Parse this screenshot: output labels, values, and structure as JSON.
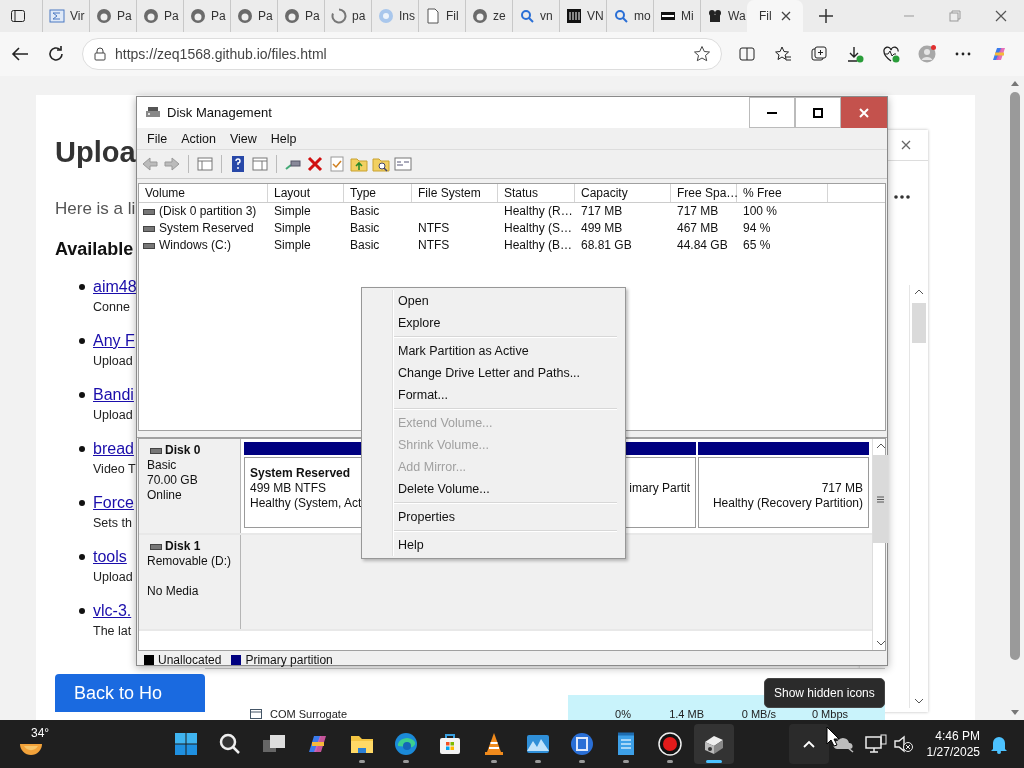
{
  "browser": {
    "tabs": [
      {
        "kind": "mail",
        "label": "Vir",
        "selected": false
      },
      {
        "kind": "github",
        "label": "Pa",
        "selected": false
      },
      {
        "kind": "github",
        "label": "Pa",
        "selected": false
      },
      {
        "kind": "github",
        "label": "Pa",
        "selected": false
      },
      {
        "kind": "github",
        "label": "Pa",
        "selected": false
      },
      {
        "kind": "github",
        "label": "Pa",
        "selected": false
      },
      {
        "kind": "ring",
        "label": "pa",
        "selected": false
      },
      {
        "kind": "circle",
        "label": "Ins",
        "selected": false
      },
      {
        "kind": "doc",
        "label": "Fil",
        "selected": false
      },
      {
        "kind": "github",
        "label": "ze",
        "selected": false
      },
      {
        "kind": "search",
        "label": "vn",
        "selected": false
      },
      {
        "kind": "bank",
        "label": "VN",
        "selected": false
      },
      {
        "kind": "search",
        "label": "mo",
        "selected": false
      },
      {
        "kind": "film",
        "label": "Mi",
        "selected": false
      },
      {
        "kind": "camera",
        "label": "Wa",
        "selected": false
      },
      {
        "kind": "loading",
        "label": "Fil",
        "selected": true
      }
    ],
    "address": "https://zeq1568.github.io/files.html"
  },
  "page": {
    "heading": "Uploa",
    "intro": "Here is a li",
    "subheading": "Available",
    "files": [
      {
        "link": "aim48",
        "description": "Conne"
      },
      {
        "link": "Any F",
        "description": "Upload"
      },
      {
        "link": "Bandi",
        "description": "Upload"
      },
      {
        "link": "bread",
        "description": "Video T"
      },
      {
        "link": "Force",
        "description": "Sets th"
      },
      {
        "link": "tools",
        "description": "Upload"
      },
      {
        "link": "vlc-3.",
        "description": "The lat"
      }
    ],
    "back_button": "Back to Ho"
  },
  "disk_management": {
    "title": "Disk Management",
    "menu": [
      "File",
      "Action",
      "View",
      "Help"
    ],
    "columns": [
      "Volume",
      "Layout",
      "Type",
      "File System",
      "Status",
      "Capacity",
      "Free Spa…",
      "% Free"
    ],
    "volumes": [
      {
        "volume": "(Disk 0 partition 3)",
        "layout": "Simple",
        "type": "Basic",
        "status": "Healthy (R…",
        "capacity": "717 MB",
        "free_space": "717 MB",
        "percent_free": "100 %"
      },
      {
        "volume": "System Reserved",
        "layout": "Simple",
        "type": "Basic",
        "file_system": "NTFS",
        "status": "Healthy (S…",
        "capacity": "499 MB",
        "free_space": "467 MB",
        "percent_free": "94 %"
      },
      {
        "volume": "Windows (C:)",
        "layout": "Simple",
        "type": "Basic",
        "file_system": "NTFS",
        "status": "Healthy (B…",
        "capacity": "68.81 GB",
        "free_space": "44.84 GB",
        "percent_free": "65 %"
      }
    ],
    "disks": [
      {
        "kind": "basic",
        "name": "Disk 0",
        "type": "Basic",
        "size": "70.00 GB",
        "status": "Online",
        "partitions": [
          {
            "name": "System Reserved",
            "detail": "499 MB NTFS",
            "status": "Healthy (System, Act"
          },
          {
            "status": "imary Partit"
          },
          {
            "detail": "717 MB",
            "status": "Healthy (Recovery Partition)"
          }
        ]
      },
      {
        "kind": "removable",
        "name": "Disk 1",
        "type": "Removable (D:)",
        "status": "No Media"
      }
    ],
    "legend": [
      {
        "label": "Unallocated",
        "color": "#000000"
      },
      {
        "label": "Primary partition",
        "color": "#000080"
      }
    ]
  },
  "context_menu": [
    {
      "kind": "item",
      "label": "Open",
      "disabled": false
    },
    {
      "kind": "item",
      "label": "Explore",
      "disabled": false
    },
    {
      "kind": "separator"
    },
    {
      "kind": "item",
      "label": "Mark Partition as Active",
      "disabled": false
    },
    {
      "kind": "item",
      "label": "Change Drive Letter and Paths...",
      "disabled": false
    },
    {
      "kind": "item",
      "label": "Format...",
      "disabled": false
    },
    {
      "kind": "separator"
    },
    {
      "kind": "item",
      "label": "Extend Volume...",
      "disabled": true
    },
    {
      "kind": "item",
      "label": "Shrink Volume...",
      "disabled": true
    },
    {
      "kind": "item",
      "label": "Add Mirror...",
      "disabled": true
    },
    {
      "kind": "item",
      "label": "Delete Volume...",
      "disabled": false
    },
    {
      "kind": "separator"
    },
    {
      "kind": "item",
      "label": "Properties",
      "disabled": false
    },
    {
      "kind": "separator"
    },
    {
      "kind": "item",
      "label": "Help",
      "disabled": false
    }
  ],
  "task_manager_row": {
    "name": "COM Surrogate",
    "cpu": "0%",
    "memory": "1.4 MB",
    "disk": "0 MB/s",
    "network": "0 Mbps"
  },
  "taskbar": {
    "weather": "34°",
    "apps": [
      {
        "kind": "start",
        "running": false,
        "selected": false
      },
      {
        "kind": "search",
        "running": false,
        "selected": false
      },
      {
        "kind": "taskview",
        "running": false,
        "selected": false
      },
      {
        "kind": "copilot",
        "running": false,
        "selected": false
      },
      {
        "kind": "folder",
        "running": true,
        "selected": false
      },
      {
        "kind": "edge",
        "running": true,
        "selected": false
      },
      {
        "kind": "store",
        "running": false,
        "selected": false
      },
      {
        "kind": "vlc",
        "running": true,
        "selected": false
      },
      {
        "kind": "photos",
        "running": true,
        "selected": false
      },
      {
        "kind": "app",
        "running": true,
        "selected": false
      },
      {
        "kind": "notepad",
        "running": true,
        "selected": false
      },
      {
        "kind": "record",
        "running": true,
        "selected": false
      },
      {
        "kind": "disk",
        "running": true,
        "selected": true
      }
    ],
    "tooltip": "Show hidden icons",
    "time": "4:46 PM",
    "date": "1/27/2025"
  }
}
